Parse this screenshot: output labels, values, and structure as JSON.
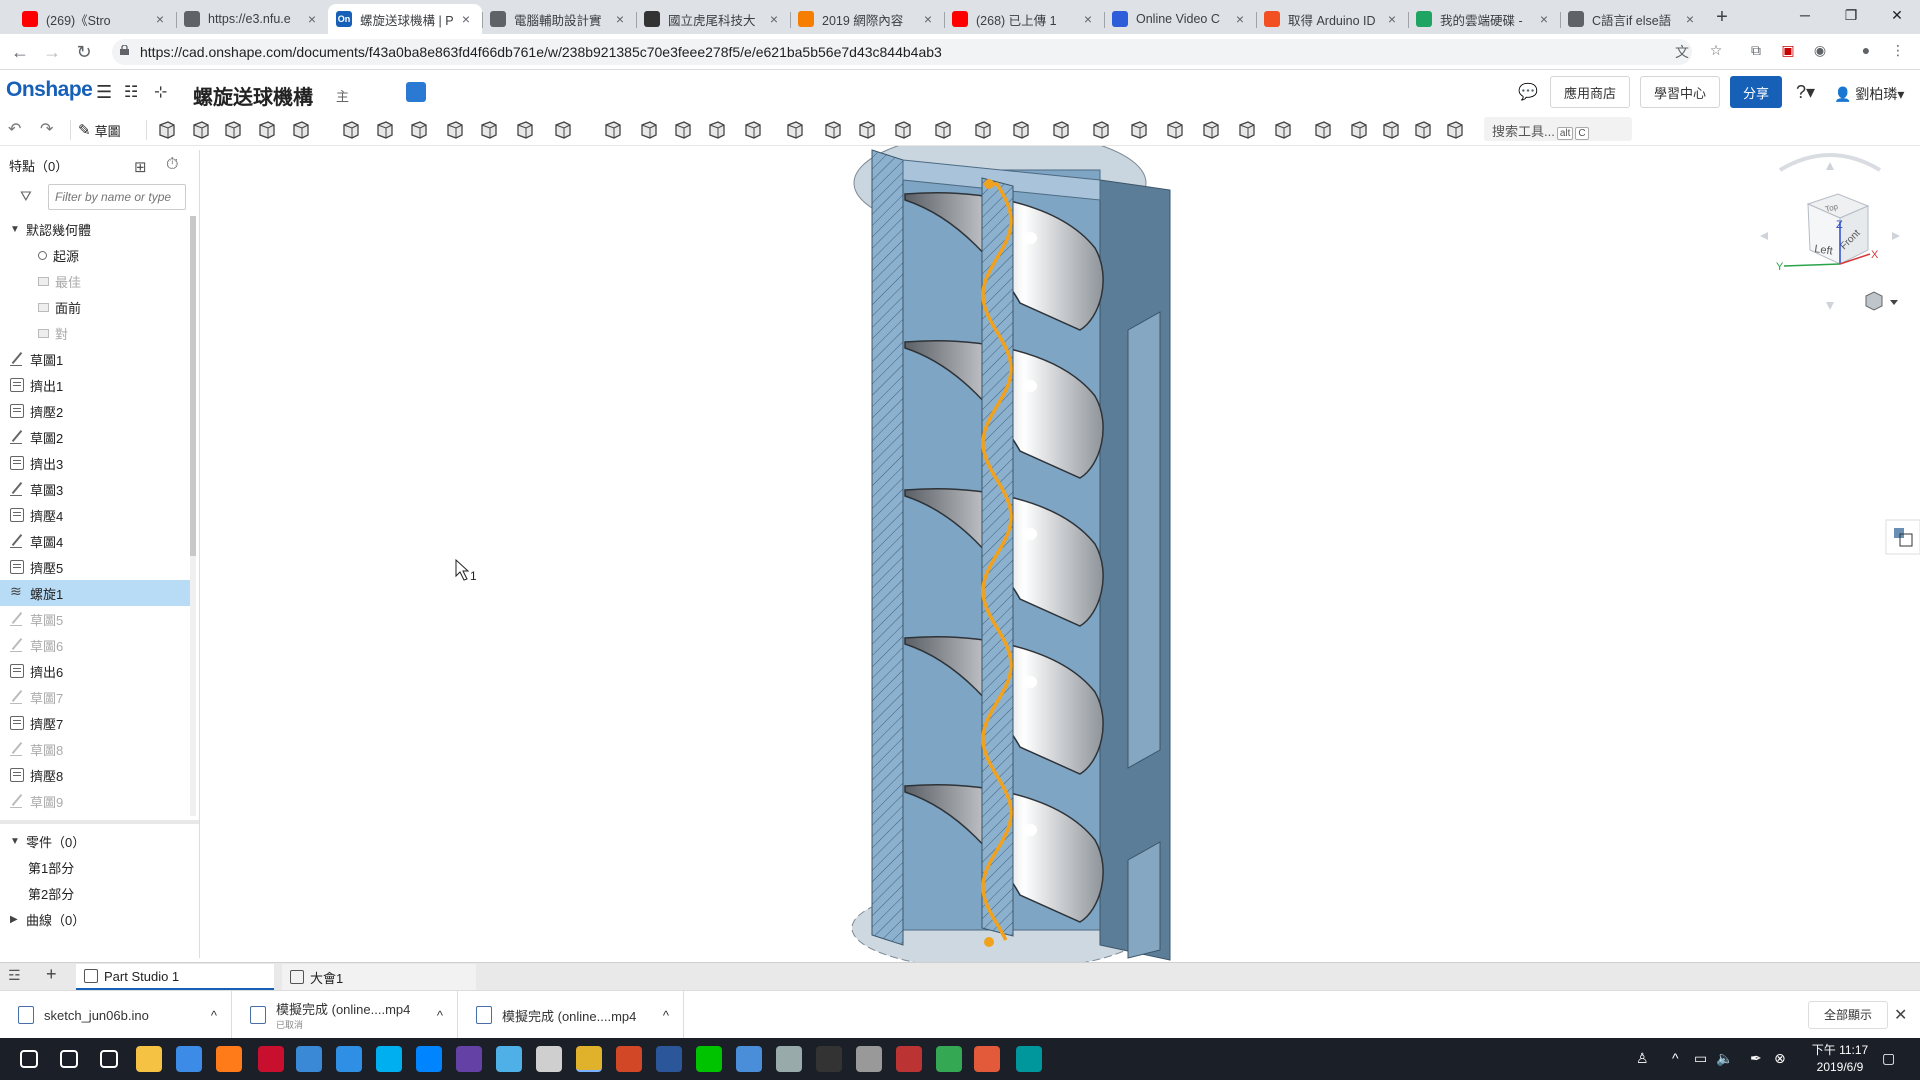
{
  "browser": {
    "tabs": [
      {
        "title": "(269)《Stro",
        "favicon_color": "#ff0000",
        "active": false
      },
      {
        "title": "https://e3.nfu.e",
        "favicon_color": "#5f6368",
        "active": false
      },
      {
        "title": "螺旋送球機構 | P",
        "favicon_color": "#1760b8",
        "favicon_text": "On",
        "active": true
      },
      {
        "title": "電腦輔助設計實",
        "favicon_color": "#5f6368",
        "active": false
      },
      {
        "title": "國立虎尾科技大",
        "favicon_color": "#333333",
        "active": false
      },
      {
        "title": "2019 網際內容",
        "favicon_color": "#f57d00",
        "active": false
      },
      {
        "title": "(268) 已上傳 1",
        "favicon_color": "#ff0000",
        "active": false
      },
      {
        "title": "Online Video C",
        "favicon_color": "#2d5dd8",
        "active": false
      },
      {
        "title": "取得 Arduino ID",
        "favicon_color": "#f25022",
        "active": false
      },
      {
        "title": "我的雲端硬碟 -",
        "favicon_color": "#1fa463",
        "active": false
      },
      {
        "title": "C語言if else語",
        "favicon_color": "#5f6368",
        "active": false
      }
    ],
    "url": "https://cad.onshape.com/documents/f43a0ba8e863fd4f66db761e/w/238b921385c70e3feee278f5/e/e621ba5b56e7d43c844b4ab3"
  },
  "header": {
    "logo": "Onshape",
    "doc_title": "螺旋送球機構",
    "branch": "主",
    "app_store": "應用商店",
    "learning": "學習中心",
    "share": "分享",
    "help": "?",
    "user": "劉柏璘"
  },
  "toolbar": {
    "sketch_label": "草圖",
    "search_placeholder": "搜索工具...",
    "search_shortcut_1": "alt",
    "search_shortcut_2": "C"
  },
  "features": {
    "title": "特點（0）",
    "filter_placeholder": "Filter by name or type",
    "default_geometry": "默認幾何體",
    "items": [
      {
        "label": "起源",
        "icon": "origin",
        "indent": 2,
        "state": "normal"
      },
      {
        "label": "最佳",
        "icon": "plane",
        "indent": 2,
        "state": "dim"
      },
      {
        "label": "面前",
        "icon": "plane",
        "indent": 2,
        "state": "normal"
      },
      {
        "label": "對",
        "icon": "plane",
        "indent": 2,
        "state": "dim"
      },
      {
        "label": "草圖1",
        "icon": "sketch",
        "indent": 0,
        "state": "normal"
      },
      {
        "label": "擠出1",
        "icon": "extrude",
        "indent": 0,
        "state": "normal"
      },
      {
        "label": "擠壓2",
        "icon": "extrude",
        "indent": 0,
        "state": "normal"
      },
      {
        "label": "草圖2",
        "icon": "sketch",
        "indent": 0,
        "state": "normal"
      },
      {
        "label": "擠出3",
        "icon": "extrude",
        "indent": 0,
        "state": "normal"
      },
      {
        "label": "草圖3",
        "icon": "sketch",
        "indent": 0,
        "state": "normal"
      },
      {
        "label": "擠壓4",
        "icon": "extrude",
        "indent": 0,
        "state": "normal"
      },
      {
        "label": "草圖4",
        "icon": "sketch",
        "indent": 0,
        "state": "normal"
      },
      {
        "label": "擠壓5",
        "icon": "extrude",
        "indent": 0,
        "state": "normal"
      },
      {
        "label": "螺旋1",
        "icon": "helix",
        "indent": 0,
        "state": "selected"
      },
      {
        "label": "草圖5",
        "icon": "sketch",
        "indent": 0,
        "state": "dim"
      },
      {
        "label": "草圖6",
        "icon": "sketch",
        "indent": 0,
        "state": "dim"
      },
      {
        "label": "擠出6",
        "icon": "extrude",
        "indent": 0,
        "state": "normal"
      },
      {
        "label": "草圖7",
        "icon": "sketch",
        "indent": 0,
        "state": "dim"
      },
      {
        "label": "擠壓7",
        "icon": "extrude",
        "indent": 0,
        "state": "normal"
      },
      {
        "label": "草圖8",
        "icon": "sketch",
        "indent": 0,
        "state": "dim"
      },
      {
        "label": "擠壓8",
        "icon": "extrude",
        "indent": 0,
        "state": "normal"
      },
      {
        "label": "草圖9",
        "icon": "sketch",
        "indent": 0,
        "state": "dim"
      }
    ]
  },
  "parts": {
    "parts_header": "零件（0）",
    "part_1": "第1部分",
    "part_2": "第2部分",
    "curves_header": "曲線（0）"
  },
  "canvas": {
    "cursor_label": "1",
    "viewcube": {
      "left": "Left",
      "front": "Front",
      "top": "Top",
      "x": "X",
      "y": "Y",
      "z": "Z"
    }
  },
  "bottom_tabs": {
    "tab1": "Part Studio 1",
    "tab2": "大會1"
  },
  "downloads": {
    "items": [
      {
        "name": "sketch_jun06b.ino",
        "sub": ""
      },
      {
        "name": "模擬完成 (online....mp4",
        "sub": "已取消"
      },
      {
        "name": "模擬完成 (online....mp4",
        "sub": ""
      }
    ],
    "show_all": "全部顯示"
  },
  "taskbar": {
    "time": "下午 11:17",
    "date": "2019/6/9"
  },
  "colors": {
    "accent": "#1760b8",
    "selection": "#b8dcf6",
    "helix": "#f0a21e",
    "model_blue": "#7fa8c8"
  }
}
